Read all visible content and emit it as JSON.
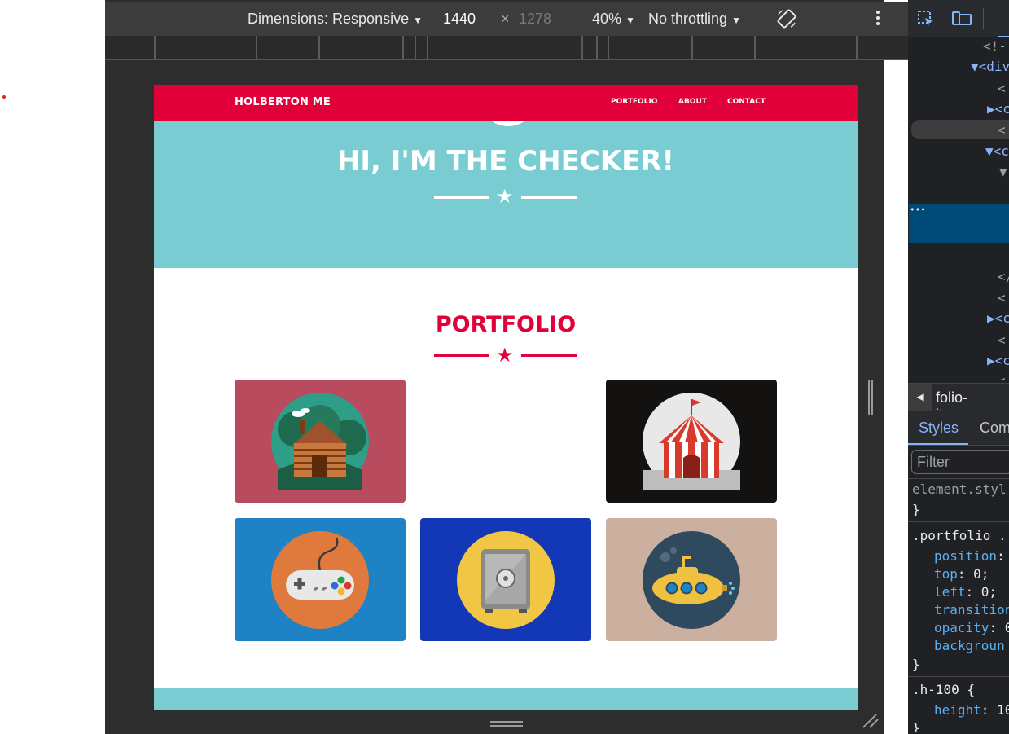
{
  "device_toolbar": {
    "dimensions_label": "Dimensions: Responsive",
    "width_value": "1440",
    "times_symbol": "×",
    "height_value": "1278",
    "zoom": "40%",
    "throttling": "No throttling",
    "more_icon": "more-vert-icon",
    "rotate_icon": "rotate-icon"
  },
  "site": {
    "brand": "HOLBERTON ME",
    "nav": [
      "PORTFOLIO",
      "ABOUT",
      "CONTACT"
    ],
    "hero_title": "HI, I'M THE CHECKER!",
    "portfolio_title": "PORTFOLIO",
    "star_glyph": "★",
    "colors": {
      "primary": "#e1003a",
      "hero_bg": "#78ccd2",
      "tile_cabin": "#b94b5f",
      "tile_circus": "#141111",
      "tile_game": "#1f82c4",
      "tile_safe": "#1238b8",
      "tile_submarine": "#cbb0a0"
    },
    "portfolio_items": [
      "cabin",
      "circus-tent",
      "game-controller",
      "safe",
      "submarine"
    ]
  },
  "devtools": {
    "code_lines": [
      "<!-",
      "▼<div",
      "<",
      "▶<c",
      "<",
      "▼<c",
      "▼",
      "•••",
      "</",
      "<",
      "▶<c",
      "<",
      "▶<c",
      "<"
    ],
    "breadcrumb": "folio-item.m",
    "tabs": [
      "Styles",
      "Com"
    ],
    "filter_placeholder": "Filter",
    "element_style": "element.styl",
    "close_brace": "}",
    "rule1_selector": ".portfolio .",
    "rule1_props": [
      {
        "name": "position",
        "value": ":"
      },
      {
        "name": "top",
        "value": ": 0;"
      },
      {
        "name": "left",
        "value": ": 0;"
      },
      {
        "name": "transition",
        "value": ""
      },
      {
        "name": "opacity",
        "value": ": 0"
      },
      {
        "name": "backgroun",
        "value": ""
      }
    ],
    "rule2_selector": ".h-100 {",
    "rule2_prop": "height",
    "rule2_value": ": 10"
  }
}
